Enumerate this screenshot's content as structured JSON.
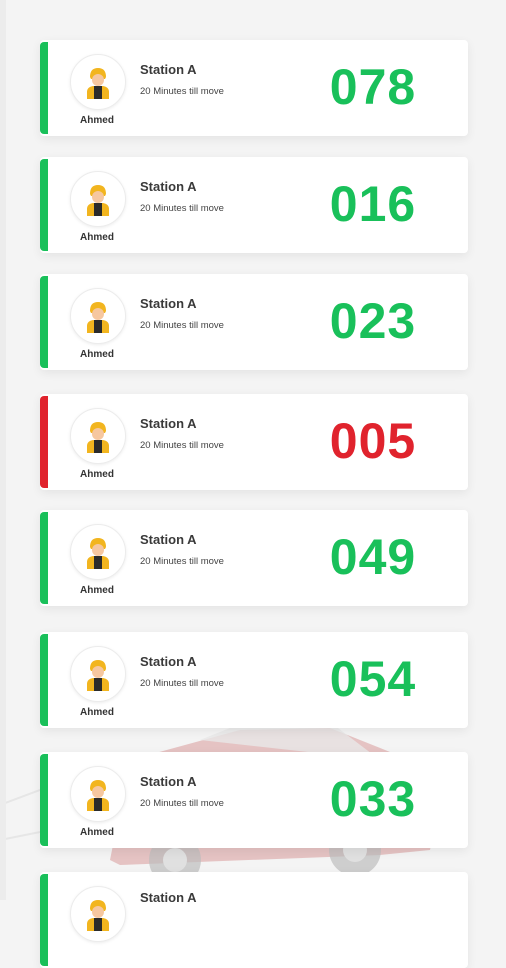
{
  "cards": [
    {
      "station": "Station A",
      "eta": "20 Minutes till move",
      "name": "Ahmed",
      "number": "078",
      "status": "ok"
    },
    {
      "station": "Station A",
      "eta": "20 Minutes till move",
      "name": "Ahmed",
      "number": "016",
      "status": "ok"
    },
    {
      "station": "Station A",
      "eta": "20 Minutes till move",
      "name": "Ahmed",
      "number": "023",
      "status": "ok"
    },
    {
      "station": "Station A",
      "eta": "20 Minutes till move",
      "name": "Ahmed",
      "number": "005",
      "status": "alert"
    },
    {
      "station": "Station A",
      "eta": "20 Minutes till move",
      "name": "Ahmed",
      "number": "049",
      "status": "ok"
    },
    {
      "station": "Station A",
      "eta": "20 Minutes till move",
      "name": "Ahmed",
      "number": "054",
      "status": "ok"
    },
    {
      "station": "Station A",
      "eta": "20 Minutes till move",
      "name": "Ahmed",
      "number": "033",
      "status": "ok"
    },
    {
      "station": "Station A",
      "eta": "",
      "name": "",
      "number": "",
      "status": "ok"
    }
  ],
  "colors": {
    "ok": "#19c05a",
    "alert": "#e0232d"
  },
  "icons": {
    "avatar": "driver-avatar-icon"
  }
}
